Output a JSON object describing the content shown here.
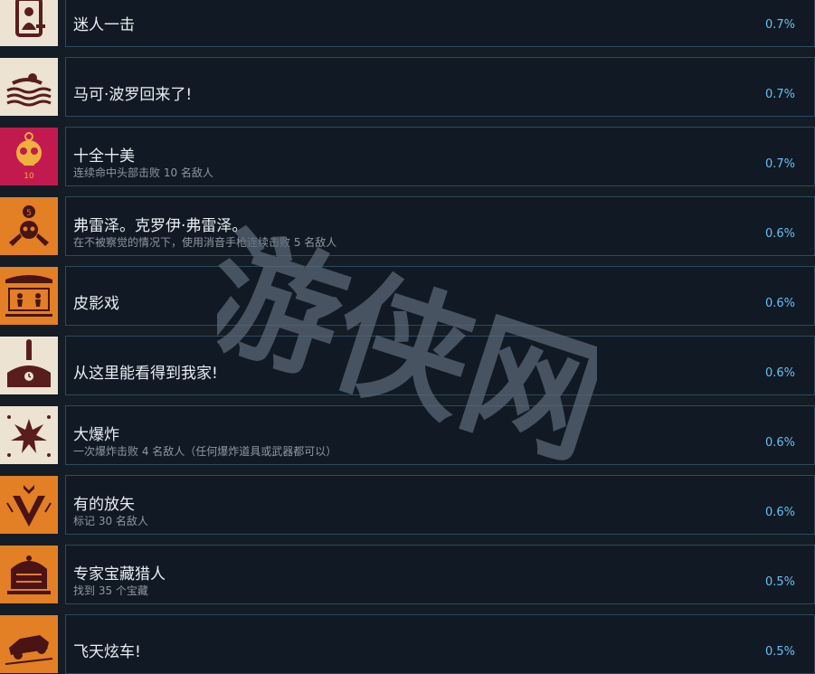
{
  "achievements": [
    {
      "title": "迷人一击",
      "description": "",
      "percent": "0.7%",
      "icon": "selfie-icon",
      "icon_bg": "#ece3d2"
    },
    {
      "title": "马可·波罗回来了!",
      "description": "",
      "percent": "0.7%",
      "icon": "swimmer-icon",
      "icon_bg": "#ece3d2"
    },
    {
      "title": "十全十美",
      "description": "连续命中头部击败 10 名敌人",
      "percent": "0.7%",
      "icon": "skull-target-icon",
      "icon_bg": "#c21a4e"
    },
    {
      "title": "弗雷泽。克罗伊·弗雷泽。",
      "description": "在不被察觉的情况下，使用消音手枪连续击败 5 名敌人",
      "percent": "0.6%",
      "icon": "skull-pistols-icon",
      "icon_bg": "#e37f24"
    },
    {
      "title": "皮影戏",
      "description": "",
      "percent": "0.6%",
      "icon": "shadow-puppets-icon",
      "icon_bg": "#e37f24"
    },
    {
      "title": "从这里能看得到我家!",
      "description": "",
      "percent": "0.6%",
      "icon": "clock-tower-icon",
      "icon_bg": "#ece3d2"
    },
    {
      "title": "大爆炸",
      "description": "一次爆炸击败 4 名敌人（任何爆炸道具或武器都可以）",
      "percent": "0.6%",
      "icon": "explosion-icon",
      "icon_bg": "#ece3d2"
    },
    {
      "title": "有的放矢",
      "description": "标记 30 名敌人",
      "percent": "0.6%",
      "icon": "mark-chevron-icon",
      "icon_bg": "#e37f24"
    },
    {
      "title": "专家宝藏猎人",
      "description": "找到 35 个宝藏",
      "percent": "0.5%",
      "icon": "treasure-crown-icon",
      "icon_bg": "#e37f24"
    },
    {
      "title": "飞天炫车!",
      "description": "",
      "percent": "0.5%",
      "icon": "flying-car-icon",
      "icon_bg": "#e37f24"
    }
  ],
  "colors": {
    "page_bg": "#141c26",
    "panel_bg": "#111a24",
    "panel_border": "#2c4a5c",
    "title": "#e8edf2",
    "description": "#8f98a0",
    "percent": "#66c0f4",
    "watermark": "#5d6a78"
  },
  "watermark": {
    "text": "游侠网"
  }
}
